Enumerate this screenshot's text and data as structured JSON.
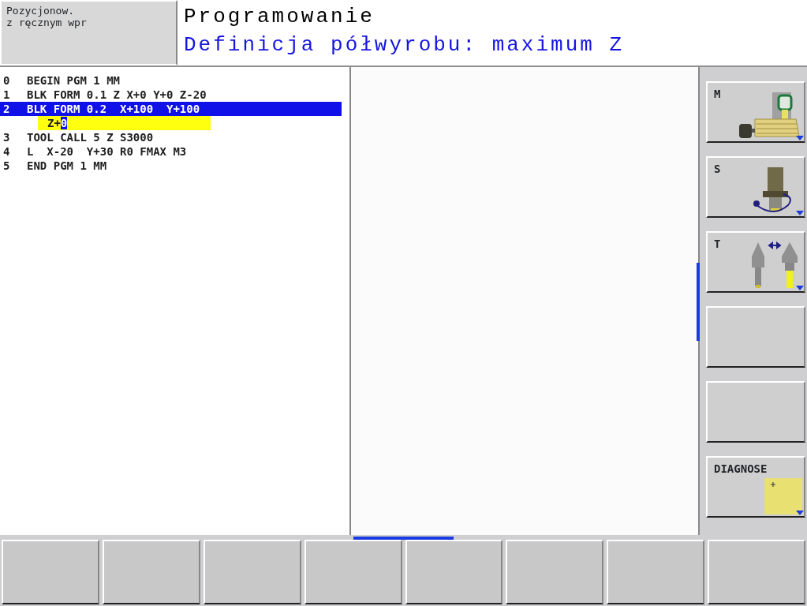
{
  "mode": {
    "lines": [
      "Pozycjonow.",
      "z ręcznym wpr"
    ]
  },
  "header": {
    "title": "Programowanie",
    "prompt": "Definicja półwyrobu: maximum Z"
  },
  "program": {
    "lines": [
      {
        "number": "0",
        "text": "BEGIN PGM 1 MM",
        "selected": false
      },
      {
        "number": "1",
        "text": "BLK FORM 0.1 Z X+0 Y+0 Z-20",
        "selected": false
      },
      {
        "number": "2",
        "text": "BLK FORM 0.2  X+100  Y+100",
        "selected": true,
        "edit": {
          "text": "Z+",
          "cursor": "0"
        }
      },
      {
        "number": "3",
        "text": "TOOL CALL 5 Z S3000",
        "selected": false
      },
      {
        "number": "4",
        "text": "L  X-20  Y+30 R0 FMAX M3",
        "selected": false
      },
      {
        "number": "5",
        "text": "END PGM 1 MM",
        "selected": false
      }
    ]
  },
  "side_softkeys": [
    {
      "kind": "machine",
      "label": "M"
    },
    {
      "kind": "spindle",
      "label": "S"
    },
    {
      "kind": "tool",
      "label": "T"
    },
    {
      "kind": "empty"
    },
    {
      "kind": "empty"
    },
    {
      "kind": "diagnose",
      "label": "DIAGNOSE"
    }
  ],
  "bottom_softkeys": [
    {
      "kind": "empty"
    },
    {
      "kind": "empty"
    },
    {
      "kind": "empty"
    },
    {
      "kind": "empty"
    },
    {
      "kind": "empty"
    },
    {
      "kind": "empty"
    },
    {
      "kind": "empty"
    },
    {
      "kind": "empty"
    }
  ]
}
